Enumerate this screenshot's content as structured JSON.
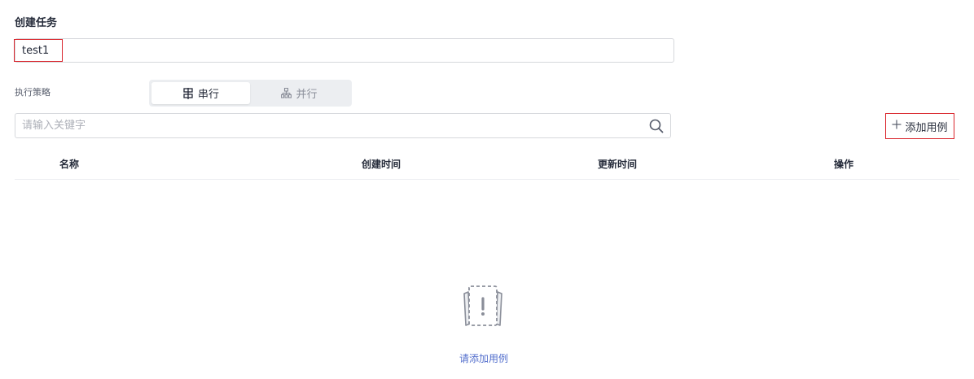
{
  "form": {
    "title": "创建任务",
    "task_name_value": "test1"
  },
  "strategy": {
    "label": "执行策略",
    "options": [
      {
        "label": "串行",
        "icon": "serial-icon",
        "active": true
      },
      {
        "label": "并行",
        "icon": "parallel-icon",
        "active": false
      }
    ]
  },
  "search": {
    "placeholder": "请输入关键字",
    "icon": "search-icon"
  },
  "toolbar": {
    "add_case_label": "添加用例",
    "add_icon": "plus-icon"
  },
  "table": {
    "columns": [
      "名称",
      "创建时间",
      "更新时间",
      "操作"
    ],
    "rows": []
  },
  "empty_state": {
    "icon": "empty-document-icon",
    "link_text": "请添加用例"
  },
  "colors": {
    "highlight": "#d9252c",
    "link": "#526ecc",
    "border": "#d6d8dc",
    "toggle_bg": "#eceef1"
  }
}
